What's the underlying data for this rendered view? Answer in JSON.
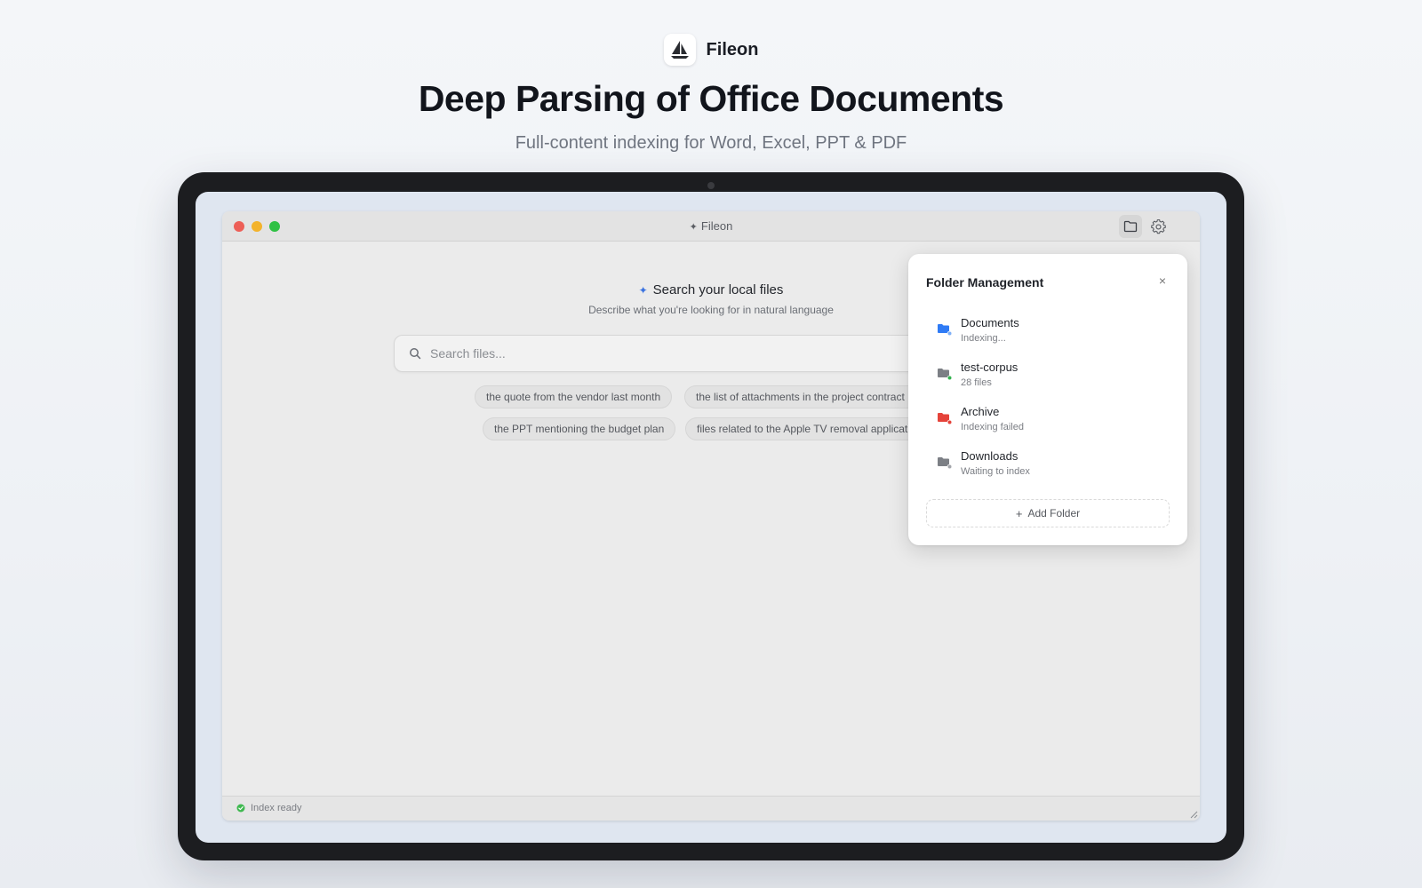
{
  "brand": {
    "name": "Fileon",
    "logo_icon": "sailboat-icon"
  },
  "hero": {
    "headline": "Deep Parsing of Office Documents",
    "subheadline": "Full-content indexing for Word, Excel, PPT & PDF"
  },
  "window": {
    "title": "Fileon",
    "title_icon": "sparkle-icon",
    "toolbar": {
      "folder_icon": "folder-icon",
      "settings_icon": "gear-icon"
    }
  },
  "search": {
    "heading": "Search your local files",
    "subheading": "Describe what you're looking for in natural language",
    "placeholder": "Search files...",
    "suggestions": [
      "the quote from the vendor last month",
      "the list of attachments in the project contract",
      "the PPT mentioning the budget plan",
      "files related to the Apple TV removal application"
    ]
  },
  "status": {
    "text": "Index ready",
    "color": "#3fb950"
  },
  "folder_panel": {
    "title": "Folder Management",
    "close_label": "×",
    "folders": [
      {
        "name": "Documents",
        "status": "Indexing...",
        "folder_color": "#2f7bf5",
        "dot_color": "#7fb0f7"
      },
      {
        "name": "test-corpus",
        "status": "28 files",
        "folder_color": "#7c7f85",
        "dot_color": "#34b34f"
      },
      {
        "name": "Archive",
        "status": "Indexing failed",
        "folder_color": "#e5433a",
        "dot_color": "#e5433a"
      },
      {
        "name": "Downloads",
        "status": "Waiting to index",
        "folder_color": "#7c7f85",
        "dot_color": "#a3a6ab"
      }
    ],
    "add_label": "Add Folder"
  }
}
